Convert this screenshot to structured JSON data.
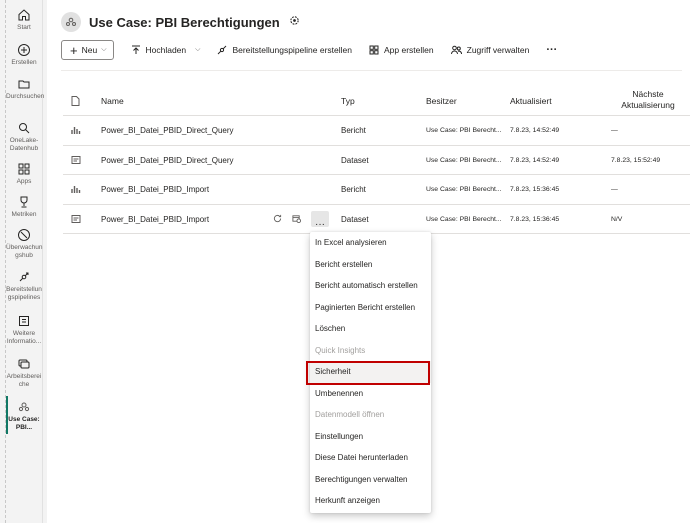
{
  "rail": {
    "items": [
      {
        "label": "Start",
        "icon": "home-icon"
      },
      {
        "label": "Erstellen",
        "icon": "create-icon"
      },
      {
        "label": "Durchsuchen",
        "icon": "browse-icon"
      },
      {
        "label": "OneLake-Datenhub",
        "icon": "onelake-icon"
      },
      {
        "label": "Apps",
        "icon": "apps-icon"
      },
      {
        "label": "Metriken",
        "icon": "metrics-icon"
      },
      {
        "label": "Überwachungshub",
        "icon": "monitoring-icon"
      },
      {
        "label": "Bereitstellungspipelines",
        "icon": "pipelines-icon"
      },
      {
        "label": "Weitere Informationen",
        "icon": "learn-icon"
      },
      {
        "label": "Arbeitsbereiche",
        "icon": "workspaces-icon"
      },
      {
        "label": "Use Case: PBI...",
        "icon": "workspace-icon"
      }
    ]
  },
  "workspace": {
    "title": "Use Case: PBI Berechtigungen"
  },
  "toolbar": {
    "new_label": "Neu",
    "upload_label": "Hochladen",
    "pipeline_label": "Bereitstellungspipeline erstellen",
    "app_label": "App erstellen",
    "access_label": "Zugriff verwalten",
    "more_label": "···"
  },
  "table": {
    "headers": {
      "name": "Name",
      "type": "Typ",
      "owner": "Besitzer",
      "updated": "Aktualisiert",
      "next_refresh_1": "Nächste",
      "next_refresh_2": "Aktualisierung"
    },
    "rows": [
      {
        "name": "Power_BI_Datei_PBID_Direct_Query",
        "type": "Bericht",
        "owner": "Use Case: PBI Berecht...",
        "updated": "7.8.23, 14:52:49",
        "next": "—",
        "icon": "report-icon"
      },
      {
        "name": "Power_BI_Datei_PBID_Direct_Query",
        "type": "Dataset",
        "owner": "Use Case: PBI Berecht...",
        "updated": "7.8.23, 14:52:49",
        "next": "7.8.23, 15:52:49",
        "icon": "dataset-icon"
      },
      {
        "name": "Power_BI_Datei_PBID_Import",
        "type": "Bericht",
        "owner": "Use Case: PBI Berecht...",
        "updated": "7.8.23, 15:36:45",
        "next": "—",
        "icon": "report-icon"
      },
      {
        "name": "Power_BI_Datei_PBID_Import",
        "type": "Dataset",
        "owner": "Use Case: PBI Berecht...",
        "updated": "7.8.23, 15:36:45",
        "next": "N/V",
        "icon": "dataset-icon"
      }
    ],
    "row_more": "···"
  },
  "context_menu": {
    "items": [
      {
        "label": "In Excel analysieren",
        "disabled": false
      },
      {
        "label": "Bericht erstellen",
        "disabled": false
      },
      {
        "label": "Bericht automatisch erstellen",
        "disabled": false
      },
      {
        "label": "Paginierten Bericht erstellen",
        "disabled": false
      },
      {
        "label": "Löschen",
        "disabled": false
      },
      {
        "label": "Quick Insights",
        "disabled": true
      },
      {
        "label": "Sicherheit",
        "disabled": false,
        "highlighted": true
      },
      {
        "label": "Umbenennen",
        "disabled": false
      },
      {
        "label": "Datenmodell öffnen",
        "disabled": true
      },
      {
        "label": "Einstellungen",
        "disabled": false
      },
      {
        "label": "Diese Datei herunterladen",
        "disabled": false
      },
      {
        "label": "Berechtigungen verwalten",
        "disabled": false
      },
      {
        "label": "Herkunft anzeigen",
        "disabled": false
      }
    ]
  },
  "colors": {
    "highlight_border": "#c00000",
    "accent": "#117865"
  }
}
